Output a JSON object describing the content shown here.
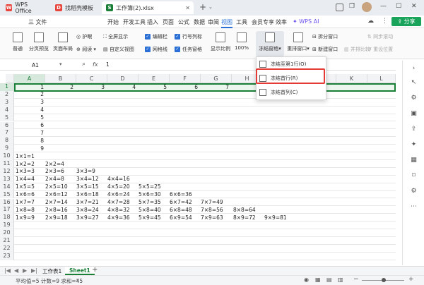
{
  "colors": {
    "accent": "#2a6fd6",
    "green": "#1a7f37",
    "wps_red": "#e8453c",
    "highlight_red": "#e53935",
    "share_green": "#1aa35b"
  },
  "tabs": [
    {
      "label": "WPS Office",
      "icon": "wps-logo-icon"
    },
    {
      "label": "找稻壳模板",
      "icon": "docer-icon"
    },
    {
      "label": "工作簿(2).xlsx",
      "icon": "spreadsheet-icon",
      "active": true
    }
  ],
  "menu": [
    "三 文件",
    "开始",
    "开发工具",
    "插入",
    "页面",
    "公式",
    "数据",
    "审阅",
    "视图",
    "工具",
    "会员专享",
    "效率"
  ],
  "active_menu": "视图",
  "wps_ai": "WPS AI",
  "share": "分享",
  "ribbon": {
    "normal": "普通",
    "page_break": "分页预览",
    "page_layout": "页面布局",
    "protect": "护眼",
    "reading": "阅读",
    "fullscreen": "全屏显示",
    "custom_view": "自定义视图",
    "edit_bar": "编辑栏",
    "grid_lines": "网格线",
    "row_col_header": "行号列标",
    "task_pane": "任务窗格",
    "show_ratio": "显示比例",
    "zoom": "100%",
    "freeze": "冻结窗格",
    "rearrange": "重排窗口",
    "split": "拆分窗口",
    "new_window": "新建窗口",
    "sync_scroll": "同步滚动",
    "side_by_side": "并排比较",
    "reset_pos": "重设位置"
  },
  "namebox": "A1",
  "fx": "fx",
  "formula_value": "1",
  "columns": [
    "A",
    "B",
    "C",
    "D",
    "E",
    "F",
    "G",
    "H",
    "I",
    "J",
    "K",
    "L"
  ],
  "rows": [
    {
      "n": "1",
      "cells": [
        "1",
        "2",
        "3",
        "4",
        "5",
        "6",
        "7"
      ]
    },
    {
      "n": "2",
      "cells": [
        "2"
      ]
    },
    {
      "n": "3",
      "cells": [
        "3"
      ]
    },
    {
      "n": "4",
      "cells": [
        "4"
      ]
    },
    {
      "n": "5",
      "cells": [
        "5"
      ]
    },
    {
      "n": "6",
      "cells": [
        "6"
      ]
    },
    {
      "n": "7",
      "cells": [
        "7"
      ]
    },
    {
      "n": "8",
      "cells": [
        "8"
      ]
    },
    {
      "n": "9",
      "cells": [
        "9"
      ]
    },
    {
      "n": "10",
      "cells": [
        "1×1=1"
      ]
    },
    {
      "n": "11",
      "cells": [
        "1×2=2",
        "2×2=4"
      ]
    },
    {
      "n": "12",
      "cells": [
        "1×3=3",
        "2×3=6",
        "3×3=9"
      ]
    },
    {
      "n": "13",
      "cells": [
        "1×4=4",
        "2×4=8",
        "3×4=12",
        "4×4=16"
      ]
    },
    {
      "n": "14",
      "cells": [
        "1×5=5",
        "2×5=10",
        "3×5=15",
        "4×5=20",
        "5×5=25"
      ]
    },
    {
      "n": "15",
      "cells": [
        "1×6=6",
        "2×6=12",
        "3×6=18",
        "4×6=24",
        "5×6=30",
        "6×6=36"
      ]
    },
    {
      "n": "16",
      "cells": [
        "1×7=7",
        "2×7=14",
        "3×7=21",
        "4×7=28",
        "5×7=35",
        "6×7=42",
        "7×7=49"
      ]
    },
    {
      "n": "17",
      "cells": [
        "1×8=8",
        "2×8=16",
        "3×8=24",
        "4×8=32",
        "5×8=40",
        "6×8=48",
        "7×8=56",
        "8×8=64"
      ]
    },
    {
      "n": "18",
      "cells": [
        "1×9=9",
        "2×9=18",
        "3×9=27",
        "4×9=36",
        "5×9=45",
        "6×9=54",
        "7×9=63",
        "8×9=72",
        "9×9=81"
      ]
    },
    {
      "n": "19",
      "cells": []
    },
    {
      "n": "20",
      "cells": []
    },
    {
      "n": "21",
      "cells": []
    },
    {
      "n": "22",
      "cells": []
    },
    {
      "n": "23",
      "cells": []
    }
  ],
  "dropdown": [
    "冻结至第1行(O)",
    "冻结首行(R)",
    "冻结首列(C)"
  ],
  "sheets": [
    "工作表1",
    "Sheet1"
  ],
  "active_sheet": "Sheet1",
  "status": "平均值=5  计数=9  求和=45"
}
